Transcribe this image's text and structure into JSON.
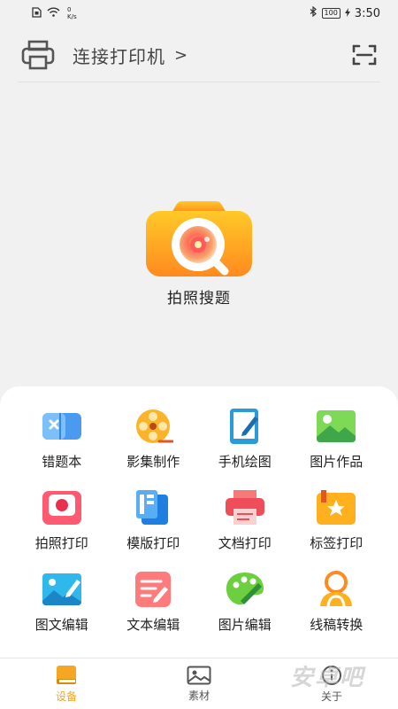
{
  "status_bar": {
    "netspeed_value": "0",
    "netspeed_unit": "K/s",
    "battery": "100",
    "time": "3:50"
  },
  "header": {
    "connect_label": "连接打印机",
    "chevron": ">"
  },
  "hero": {
    "label": "拍照搜题"
  },
  "tools": [
    {
      "label": "错题本",
      "icon": "wrongbook-icon"
    },
    {
      "label": "影集制作",
      "icon": "film-reel-icon"
    },
    {
      "label": "手机绘图",
      "icon": "tablet-draw-icon"
    },
    {
      "label": "图片作品",
      "icon": "picture-icon"
    },
    {
      "label": "拍照打印",
      "icon": "photo-print-icon"
    },
    {
      "label": "模版打印",
      "icon": "template-icon"
    },
    {
      "label": "文档打印",
      "icon": "document-print-icon"
    },
    {
      "label": "标签打印",
      "icon": "label-print-icon"
    },
    {
      "label": "图文编辑",
      "icon": "image-text-edit-icon"
    },
    {
      "label": "文本编辑",
      "icon": "text-edit-icon"
    },
    {
      "label": "图片编辑",
      "icon": "palette-icon"
    },
    {
      "label": "线稿转换",
      "icon": "line-art-icon"
    }
  ],
  "bottom_nav": [
    {
      "label": "设备",
      "active": true
    },
    {
      "label": "素材",
      "active": false
    },
    {
      "label": "关于",
      "active": false
    }
  ],
  "watermark": "安卓吧",
  "colors": {
    "accent": "#f5a623",
    "camera_yellow": "#fdb813",
    "camera_orange": "#ff8a1f"
  }
}
